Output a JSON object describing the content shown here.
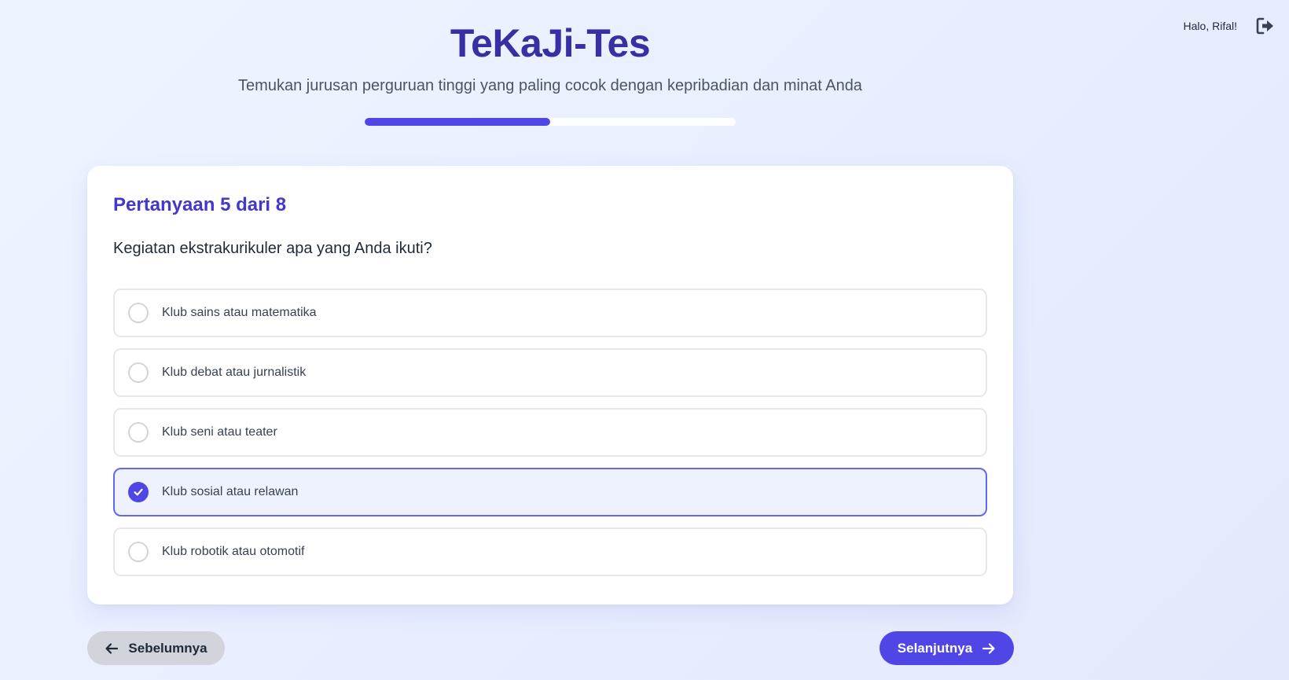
{
  "user": {
    "greeting": "Halo, Rifal!",
    "logout_icon": "logout-icon"
  },
  "header": {
    "title": "TeKaJi-Tes",
    "subtitle": "Temukan jurusan perguruan tinggi yang paling cocok dengan kepribadian dan minat Anda"
  },
  "progress": {
    "percent": 50
  },
  "question": {
    "number_label": "Pertanyaan 5 dari 8",
    "text": "Kegiatan ekstrakurikuler apa yang Anda ikuti?",
    "options": [
      {
        "label": "Klub sains atau matematika",
        "selected": false
      },
      {
        "label": "Klub debat atau jurnalistik",
        "selected": false
      },
      {
        "label": "Klub seni atau teater",
        "selected": false
      },
      {
        "label": "Klub sosial atau relawan",
        "selected": true
      },
      {
        "label": "Klub robotik atau otomotif",
        "selected": false
      }
    ]
  },
  "nav": {
    "prev_label": "Sebelumnya",
    "next_label": "Selanjutnya",
    "prev_icon": "arrow-left-icon",
    "next_icon": "arrow-right-icon"
  },
  "colors": {
    "primary": "#4f46e5",
    "title": "#3730a3",
    "question_number": "#4338ca",
    "selected_bg": "#eef2ff",
    "selected_border": "#6366f1",
    "prev_button_bg": "#d1d5db"
  }
}
